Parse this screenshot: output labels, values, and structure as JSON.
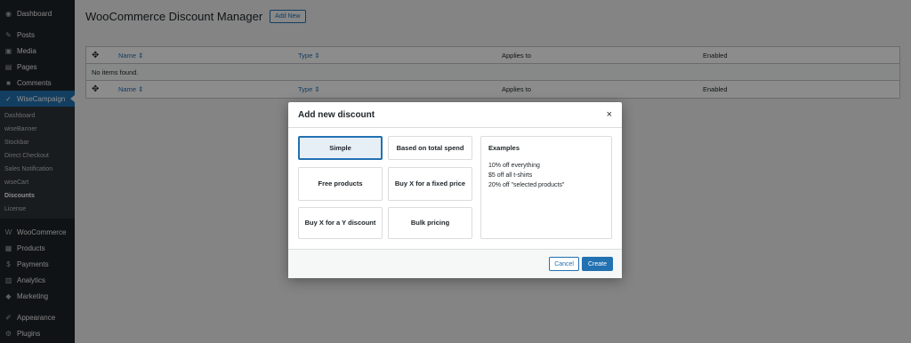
{
  "sidebar": {
    "items_top": [
      {
        "label": "Dashboard",
        "icon": "dashboard-icon"
      },
      {
        "label": "Posts",
        "icon": "pin-icon"
      },
      {
        "label": "Media",
        "icon": "media-icon"
      },
      {
        "label": "Pages",
        "icon": "pages-icon"
      },
      {
        "label": "Comments",
        "icon": "comments-icon"
      }
    ],
    "active": {
      "label": "WiseCampaign",
      "icon": "wisecampaign-icon"
    },
    "submenu": [
      "Dashboard",
      "wiseBanner",
      "Stockbar",
      "Direct Checkout",
      "Sales Notification",
      "wiseCart",
      "Discounts",
      "License"
    ],
    "items_bottom": [
      {
        "label": "WooCommerce",
        "icon": "woocommerce-icon"
      },
      {
        "label": "Products",
        "icon": "products-icon"
      },
      {
        "label": "Payments",
        "icon": "payments-icon"
      },
      {
        "label": "Analytics",
        "icon": "analytics-icon"
      },
      {
        "label": "Marketing",
        "icon": "marketing-icon"
      }
    ],
    "items_last": [
      {
        "label": "Appearance",
        "icon": "appearance-icon"
      },
      {
        "label": "Plugins",
        "icon": "plugins-icon"
      }
    ]
  },
  "header": {
    "title": "WooCommerce Discount Manager",
    "add_new": "Add New"
  },
  "table": {
    "columns": {
      "name": "Name ⇕",
      "type": "Type ⇕",
      "applies": "Applies to",
      "enabled": "Enabled"
    },
    "empty": "No items found."
  },
  "modal": {
    "title": "Add new discount",
    "close": "×",
    "options": [
      "Simple",
      "Based on total spend",
      "Free products",
      "Buy X for a fixed price",
      "Buy X for a Y discount",
      "Bulk pricing"
    ],
    "examples": {
      "title": "Examples",
      "lines": [
        "10% off everything",
        "$5 off all t-shirts",
        "20% off \"selected products\""
      ]
    },
    "cancel": "Cancel",
    "create": "Create"
  },
  "colors": {
    "accent": "#2271b1",
    "sidebar": "#1d2327"
  }
}
